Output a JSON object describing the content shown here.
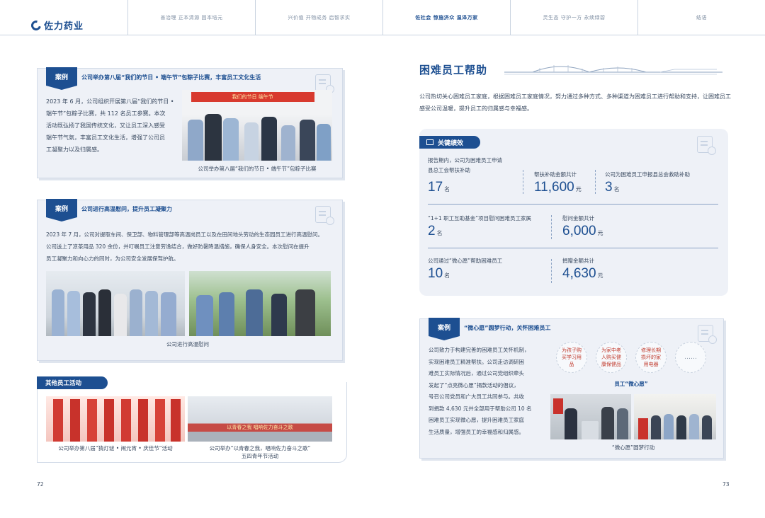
{
  "nav": {
    "brand": "佐力药业",
    "sections": [
      {
        "label": "善治理 正本清源 固本培元",
        "active": false
      },
      {
        "label": "兴价值 开物成务 启智求实",
        "active": false
      },
      {
        "label": "佐社会 惊施济众 温泽万家",
        "active": true
      },
      {
        "label": "灵生态 守护一方 永续绿碧",
        "active": false
      },
      {
        "label": "结语",
        "active": false
      }
    ]
  },
  "left": {
    "case1": {
      "tag": "案例",
      "title": "公司举办第八届“我们的节日 • 端午节”包粽子比赛，丰富员工文化生活",
      "lines": [
        "2023 年 6 月，公司组织开展第八届“我们的节日 •",
        "端午节”包粽子比赛，共 112 名员工参赛。本次",
        "活动既弘扬了我国传统文化，又让员工深入感受",
        "端午节气氛，丰富员工文化生活，增强了公司员",
        "工凝聚力以及归属感。"
      ],
      "photo_banner": "我们的节日 端午节",
      "caption": "公司举办第八届“我们的节日 • 端午节”包粽子比赛"
    },
    "case2": {
      "tag": "案例",
      "title": "公司进行高温慰问，提升员工凝聚力",
      "lines": [
        "2023 年 7 月，公司对提取车间、保卫部、物料管理部等高温岗员工以及在田间地头劳动的生态园员工进行高温慰问。",
        "公司送上了凉茶用品 320 余份，并叮嘱员工注意劳逸结合，做好防暑降温措施，确保人身安全。本次慰问在提升",
        "员工凝聚力和向心力的同时，为公司安全发展保驾护航。"
      ],
      "caption": "公司进行高温慰问"
    },
    "other": {
      "tag": "其他员工活动",
      "caption1": "公司举办第八届“猜灯谜 • 闹元宵 • 庆佳节”活动",
      "caption2_line1": "公司举办“以青春之我，唱响佐力奋斗之歌”",
      "caption2_line2": "五四青年节活动",
      "photo2_banner": "以青春之我 唱响佐力奋斗之歌"
    },
    "page": "72"
  },
  "right": {
    "title": "困难员工帮助",
    "intro": "公司热切关心困难员工家庭，根据困难员工家庭情况，努力通过多种方式、多种渠道为困难员工进行帮助和支持，让困难员工感受公司温暖，提升员工的归属感与幸福感。",
    "kpi": {
      "tag": "关键绩效",
      "row1": [
        {
          "label1": "报告期内，公司为困难员工申请",
          "label2": "县总工会帮扶补助",
          "value": "17",
          "unit": "名"
        },
        {
          "label1": "",
          "label2": "帮扶补助金额共计",
          "value": "11,600",
          "unit": "元"
        },
        {
          "label1": "",
          "label2": "公司为困难员工申报县总会救助补助",
          "value": "3",
          "unit": "名"
        }
      ],
      "row2": [
        {
          "label": "“1+1 职工互助基金”项目慰问困难员工家属",
          "value": "2",
          "unit": "名"
        },
        {
          "label": "慰问金额共计",
          "value": "6,000",
          "unit": "元"
        }
      ],
      "row3": [
        {
          "label": "公司通过“微心愿”帮助困难员工",
          "value": "10",
          "unit": "名"
        },
        {
          "label": "捐赠金额共计",
          "value": "4,630",
          "unit": "元"
        }
      ]
    },
    "case3": {
      "tag": "案例",
      "title": "“微心愿”圆梦行动，关怀困难员工",
      "lines": [
        "公司致力于构建完善的困难员工关怀机制，",
        "实现困难员工精准帮扶。公司走访调研困",
        "难员工实际情况后，通过公司党组织牵头",
        "发起了“点亮微心愿”捐款活动的倡议，",
        "号召公司党员和广大员工共同参与。共收",
        "到捐款 4,630 元并全部用于帮助公司 10 名",
        "困难员工实现微心愿，提升困难员工家庭",
        "生活质量，增强员工的幸福感和归属感。"
      ],
      "bubbles": [
        "为孩子购买学习用品",
        "为家中老人购买健康保健品",
        "修理长期损坏的家用电器",
        "……"
      ],
      "bubble_caption": "员工“微心愿”",
      "caption": "“微心愿”圆梦行动"
    },
    "page": "73"
  }
}
